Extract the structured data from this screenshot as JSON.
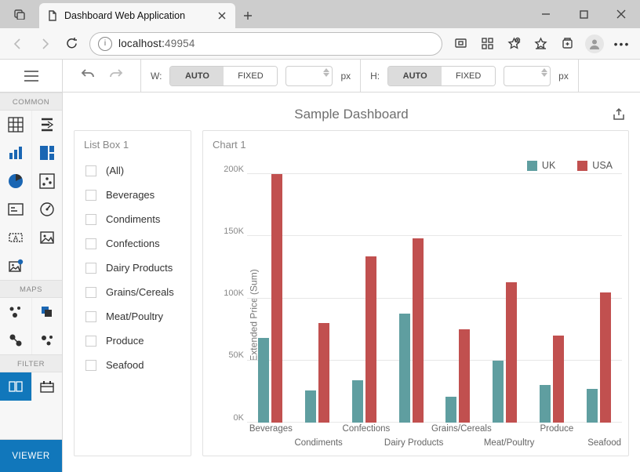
{
  "browser": {
    "tab_title": "Dashboard Web Application",
    "url_host": "localhost:",
    "url_port": "49954"
  },
  "toolbar": {
    "width_label": "W:",
    "height_label": "H:",
    "mode_auto": "AUTO",
    "mode_fixed": "FIXED",
    "unit": "px"
  },
  "sidebar": {
    "section_common": "COMMON",
    "section_maps": "MAPS",
    "section_filter": "FILTER",
    "viewer_label": "VIEWER"
  },
  "dashboard": {
    "title": "Sample Dashboard",
    "listbox_title": "List Box 1",
    "chart_title": "Chart 1",
    "list_items": [
      "(All)",
      "Beverages",
      "Condiments",
      "Confections",
      "Dairy Products",
      "Grains/Cereals",
      "Meat/Poultry",
      "Produce",
      "Seafood"
    ]
  },
  "chart_data": {
    "type": "bar",
    "title": "Chart 1",
    "ylabel": "Extended Price (Sum)",
    "xlabel": "",
    "ylim": [
      0,
      200
    ],
    "yticks": [
      "0K",
      "50K",
      "100K",
      "150K",
      "200K"
    ],
    "categories": [
      "Beverages",
      "Condiments",
      "Confections",
      "Dairy Products",
      "Grains/Cereals",
      "Meat/Poultry",
      "Produce",
      "Seafood"
    ],
    "series": [
      {
        "name": "UK",
        "color": "#5f9ea0",
        "values": [
          68,
          26,
          34,
          88,
          21,
          50,
          30,
          27
        ]
      },
      {
        "name": "USA",
        "color": "#c1504f",
        "values": [
          200,
          80,
          134,
          148,
          75,
          113,
          70,
          105
        ]
      }
    ],
    "stagger_rows": [
      0,
      1,
      0,
      1,
      0,
      1,
      0,
      1
    ]
  }
}
